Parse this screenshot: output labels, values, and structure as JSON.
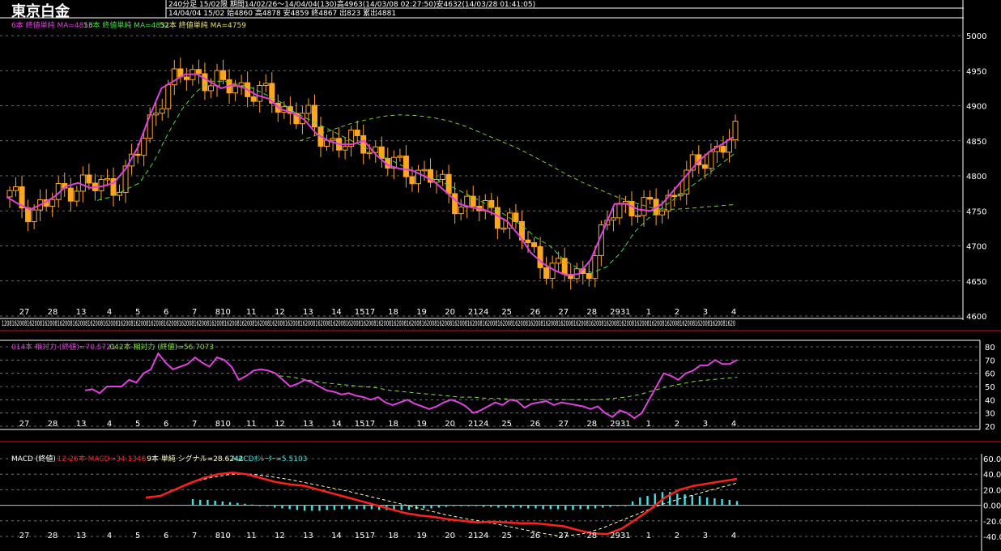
{
  "header": {
    "title": "東京白金",
    "info_line1": "240分足 15/02限  期間14/02/26～14/04/04(130)高4963(14/03/08 02:27:50)安4632(14/03/28 01:41:05)",
    "info_line2": "14/04/04 15/02 始4860 高4878 安4859 終4867 出823 累出4881"
  },
  "colors": {
    "background": "#000000",
    "candle": "#ffa621",
    "ma6": "#e040e0",
    "ma13": "#40e040",
    "ma52": "#e8e060",
    "rsi14": "#e040e0",
    "rsi42": "#80e040",
    "macd": "#ff2020",
    "signal": "#ffffc0",
    "osc": "#40e0e0",
    "separator": "#d01010"
  },
  "x_day_labels": [
    "27",
    "28",
    "13",
    "4",
    "5",
    "6",
    "7",
    "810",
    "11",
    "12",
    "13",
    "14",
    "1517",
    "18",
    "19",
    "20",
    "2124",
    "25",
    "26",
    "27",
    "28",
    "2931",
    "1",
    "2",
    "3",
    "4"
  ],
  "x_hour_pattern": "12081620081620081620081620081620081620081620081620081620081620081620081620081620081620081620081620081620081620081620081620081620081620081620081620081620081620081620081620081620081620081620081620081620081620081620081620081620081620081620081620081620081620081620081620081620081620081620081620",
  "chart_data": [
    {
      "type": "candlestick",
      "legend": [
        {
          "text": "6本 終値単純 MA=4856",
          "color": "#e040e0"
        },
        {
          "text": "13本 終値単純 MA=4831",
          "color": "#40e040"
        },
        {
          "text": "52本 終値単純 MA=4759",
          "color": "#e8e060"
        }
      ],
      "y_ticks": [
        "5000",
        "4950",
        "4900",
        "4850",
        "4800",
        "4750",
        "4700",
        "4650",
        "4600"
      ],
      "ylim": [
        4600,
        5000
      ],
      "series": [
        {
          "name": "6本 終値単純 MA",
          "values": [
            4770,
            4760,
            4752,
            4760,
            4770,
            4785,
            4790,
            4783,
            4785,
            4790,
            4810,
            4840,
            4885,
            4925,
            4935,
            4945,
            4945,
            4935,
            4925,
            4930,
            4925,
            4915,
            4910,
            4895,
            4890,
            4880,
            4860,
            4850,
            4845,
            4845,
            4850,
            4830,
            4815,
            4810,
            4808,
            4800,
            4790,
            4775,
            4760,
            4755,
            4752,
            4745,
            4735,
            4715,
            4690,
            4675,
            4665,
            4658,
            4660,
            4680,
            4720,
            4760,
            4760,
            4752,
            4750,
            4760,
            4780,
            4800,
            4820,
            4835,
            4845,
            4856
          ]
        },
        {
          "name": "13本 終値単純 MA",
          "values": [
            4765,
            4770,
            4780,
            4790,
            4820,
            4860,
            4895,
            4920,
            4935,
            4935,
            4930,
            4925,
            4915,
            4905,
            4890,
            4880,
            4870,
            4860,
            4850,
            4840,
            4830,
            4820,
            4810,
            4800,
            4795,
            4785,
            4775,
            4765,
            4755,
            4742,
            4730,
            4712,
            4700,
            4680,
            4668,
            4662,
            4670,
            4690,
            4720,
            4740,
            4755,
            4770,
            4785,
            4800,
            4815,
            4831
          ]
        },
        {
          "name": "52本 終値単純 MA",
          "values": [
            4850,
            4858,
            4866,
            4874,
            4880,
            4885,
            4887,
            4886,
            4883,
            4878,
            4870,
            4860,
            4850,
            4840,
            4828,
            4815,
            4802,
            4790,
            4780,
            4770,
            4762,
            4755,
            4752,
            4753,
            4755,
            4757,
            4759
          ]
        }
      ]
    },
    {
      "type": "line",
      "legend": [
        {
          "text": "014本 相対力 (終値)=70.5721",
          "color": "#e040e0"
        },
        {
          "text": "042本 相対力 (終値)=56.7073",
          "color": "#80e040"
        }
      ],
      "y_ticks": [
        "80",
        "70",
        "60",
        "50",
        "40",
        "30",
        "20"
      ],
      "ylim": [
        20,
        80
      ],
      "series": [
        {
          "name": "014本 相対力 (終値)",
          "values": [
            47,
            48,
            45,
            50,
            50,
            50,
            55,
            53,
            60,
            63,
            75,
            68,
            63,
            65,
            67,
            72,
            68,
            65,
            72,
            70,
            65,
            55,
            58,
            62,
            63,
            62,
            60,
            55,
            50,
            52,
            55,
            53,
            50,
            47,
            46,
            44,
            45,
            43,
            42,
            40,
            42,
            38,
            36,
            38,
            40,
            37,
            35,
            33,
            35,
            38,
            40,
            38,
            35,
            30,
            32,
            35,
            38,
            36,
            40,
            39,
            34,
            37,
            38,
            39,
            36,
            38,
            37,
            36,
            35,
            33,
            35,
            30,
            27,
            32,
            30,
            26,
            30,
            40,
            50,
            60,
            58,
            55,
            60,
            62,
            66,
            66,
            70,
            67,
            67,
            70
          ]
        },
        {
          "name": "042本 相対力 (終値)",
          "values": [
            58,
            57,
            55,
            53,
            52,
            51,
            50,
            49,
            47,
            46,
            45,
            44,
            43,
            42,
            42,
            41,
            41,
            40,
            40,
            40,
            40,
            40,
            40,
            40,
            41,
            42,
            44,
            47,
            50,
            52,
            54,
            55,
            56,
            57
          ]
        }
      ]
    },
    {
      "type": "line",
      "legend": [
        {
          "text": "MACD (終値)",
          "color": "#ffffff"
        },
        {
          "text": "12-26本 MACD=34.1346",
          "color": "#ff2020"
        },
        {
          "text": "9本 単純 シグナル=28.6242",
          "color": "#ffffc0"
        },
        {
          "text": "MACDｵｼﾚｰﾀｰ=5.5103",
          "color": "#40e0e0"
        }
      ],
      "y_ticks": [
        "60.0000",
        "40.0000",
        "20.0000",
        "0.0000",
        "-20.0000",
        "-40.0000"
      ],
      "ylim": [
        -40,
        60
      ],
      "series": [
        {
          "name": "12-26本 MACD",
          "values": [
            10,
            12,
            20,
            28,
            35,
            40,
            42,
            40,
            35,
            30,
            27,
            25,
            20,
            15,
            10,
            5,
            0,
            -5,
            -10,
            -13,
            -15,
            -18,
            -20,
            -22,
            -21,
            -22,
            -23,
            -23,
            -25,
            -27,
            -32,
            -36,
            -37,
            -30,
            -18,
            -5,
            10,
            20,
            25,
            28,
            31,
            34
          ]
        },
        {
          "name": "9本 単純 シグナル",
          "values": [
            30,
            36,
            40,
            40,
            37,
            33,
            28,
            23,
            18,
            12,
            6,
            0,
            -6,
            -12,
            -17,
            -21,
            -26,
            -31,
            -36,
            -40,
            -37,
            -30,
            -20,
            -10,
            0,
            8,
            15,
            22,
            28.6
          ]
        },
        {
          "name": "MACDｵｼﾚｰﾀｰ",
          "values": [
            8,
            7,
            7,
            6,
            5,
            4,
            3,
            2,
            1,
            0,
            -1,
            -3,
            -4,
            -5,
            -6,
            -7,
            -7,
            -7,
            -6,
            -6,
            -5,
            -5,
            -5,
            -5,
            -5,
            -6,
            -6,
            -6,
            -6,
            -6,
            -5,
            -4,
            -4,
            -3,
            -2,
            -1,
            0,
            -1,
            -1,
            -2,
            -2,
            -3,
            -3,
            -3,
            -3,
            -4,
            -4,
            -5,
            -5,
            -5,
            -6,
            -6,
            -5,
            -5,
            -4,
            -3,
            -2,
            -1,
            0,
            5,
            10,
            12,
            15,
            17,
            17,
            15,
            14,
            13,
            12,
            10,
            9,
            8,
            7,
            5.5
          ]
        }
      ]
    }
  ]
}
